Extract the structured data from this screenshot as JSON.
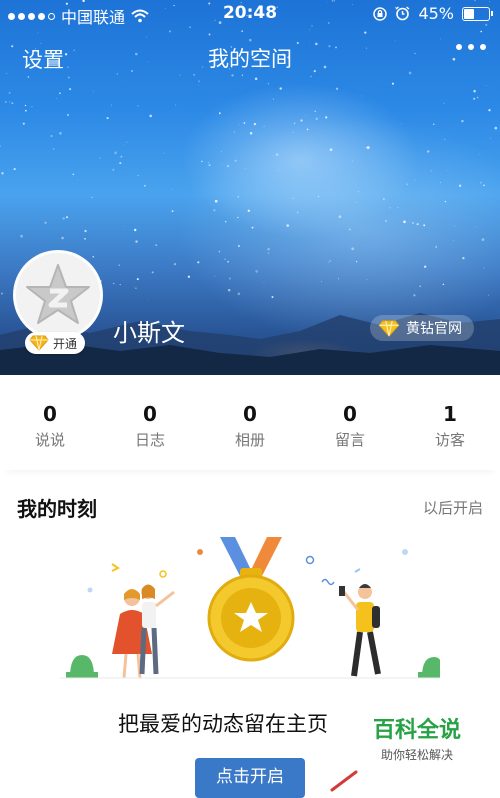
{
  "status_bar": {
    "carrier": "中国联通",
    "time": "20:48",
    "battery_text": "45%",
    "battery_level": 0.45,
    "icons": [
      "signal-dots-icon",
      "wifi-icon",
      "orientation-lock-icon",
      "alarm-icon",
      "battery-icon"
    ]
  },
  "nav": {
    "settings_label": "设置",
    "title": "我的空间",
    "more_icon": "more-dots-icon"
  },
  "profile": {
    "username": "小斯文",
    "vip_badge_label": "开通",
    "yellow_diamond_label": "黄钻官网",
    "avatar_icon": "qzone-star-avatar-icon",
    "diamond_icon": "diamond-icon"
  },
  "stats": [
    {
      "count": "0",
      "label": "说说"
    },
    {
      "count": "0",
      "label": "日志"
    },
    {
      "count": "0",
      "label": "相册"
    },
    {
      "count": "0",
      "label": "留言"
    },
    {
      "count": "1",
      "label": "访客"
    }
  ],
  "moments": {
    "title": "我的时刻",
    "later_label": "以后开启",
    "description": "把最爱的动态留在主页",
    "open_button_label": "点击开启",
    "illustration_icon": "medal-with-people-illustration"
  },
  "watermark": {
    "title": "百科全说",
    "subtitle": "助你轻松解决"
  },
  "colors": {
    "sky": "#2d8ae6",
    "button_blue": "#3a78c8",
    "medal_gold": "#f4c92e",
    "watermark_green": "#27a245"
  }
}
